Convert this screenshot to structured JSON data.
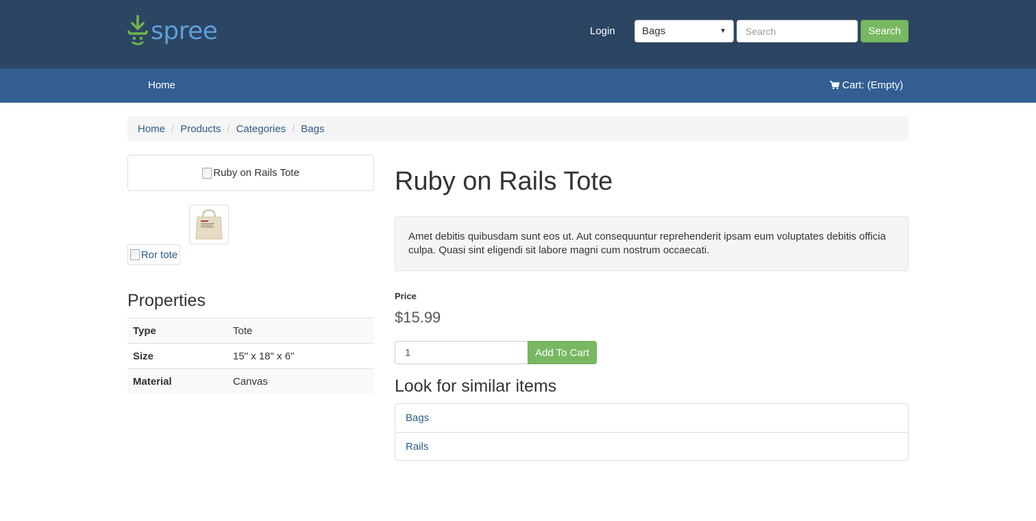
{
  "header": {
    "logo_text": "spree",
    "login_label": "Login",
    "taxon_select_value": "Bags",
    "search_placeholder": "Search",
    "search_button_label": "Search",
    "colors": {
      "topbar": "#2c4563",
      "navbar": "#325e91",
      "accent_green": "#78b862",
      "link": "#2d5a8a"
    }
  },
  "nav": {
    "home_label": "Home",
    "cart_label": "Cart: (Empty)",
    "cart_icon": "shopping-cart-icon"
  },
  "breadcrumb": {
    "items": [
      "Home",
      "Products",
      "Categories",
      "Bags"
    ],
    "separator": "/"
  },
  "product": {
    "main_image_alt": "Ruby on Rails Tote",
    "thumb_alt": "Ror tote",
    "title": "Ruby on Rails Tote",
    "description": "Amet debitis quibusdam sunt eos ut. Aut consequuntur reprehenderit ipsam eum voluptates debitis officia culpa. Quasi sint eligendi sit labore magni cum nostrum occaecati.",
    "price_label": "Price",
    "price": "$15.99",
    "quantity": "1",
    "add_to_cart_label": "Add To Cart"
  },
  "properties": {
    "title": "Properties",
    "rows": [
      {
        "key": "Type",
        "value": "Tote"
      },
      {
        "key": "Size",
        "value": "15\" x 18\" x 6\""
      },
      {
        "key": "Material",
        "value": "Canvas"
      }
    ]
  },
  "similar": {
    "title": "Look for similar items",
    "items": [
      "Bags",
      "Rails"
    ]
  }
}
